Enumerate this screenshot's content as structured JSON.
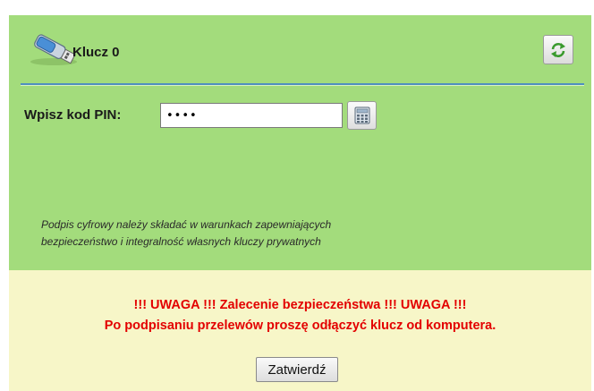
{
  "header": {
    "key_name": "Klucz 0",
    "icons": {
      "device": "usb-key-icon",
      "refresh": "refresh-icon"
    }
  },
  "pin": {
    "label": "Wpisz kod PIN:",
    "value": "••••",
    "keypad_icon": "keypad-icon"
  },
  "note": {
    "line1": "Podpis cyfrowy należy składać  w warunkach zapewniających",
    "line2": "bezpieczeństwo i integralność własnych kluczy prywatnych"
  },
  "warning": {
    "line1": "!!! UWAGA !!! Zalecenie bezpieczeństwa !!! UWAGA !!!",
    "line2": "Po podpisaniu przelewów proszę odłączyć klucz od komputera."
  },
  "actions": {
    "submit_label": "Zatwierdź"
  },
  "colors": {
    "panel_green": "#a3dc7c",
    "panel_yellow": "#f7f6c8",
    "warning_red": "#e30000",
    "divider_blue": "#4f8fc0"
  }
}
